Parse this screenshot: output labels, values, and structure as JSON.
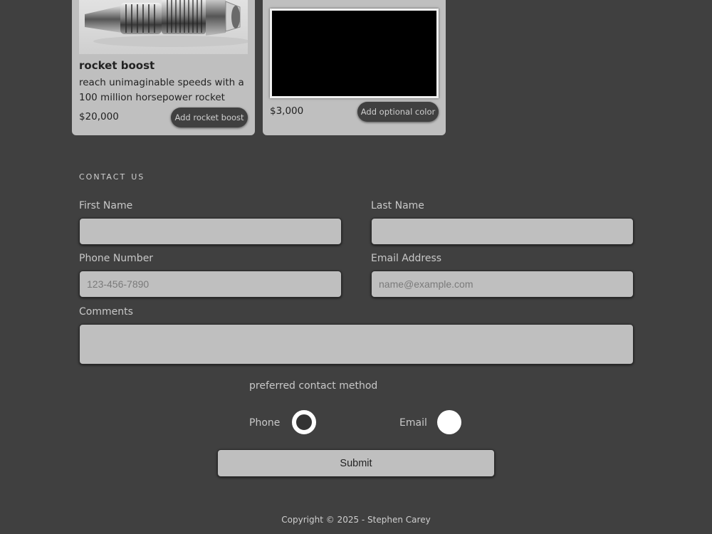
{
  "products": {
    "rocket": {
      "title": "rocket boost",
      "description": "reach unimaginable speeds with a 100 million horsepower rocket",
      "price": "$20,000",
      "button_label": "Add rocket boost"
    },
    "color": {
      "price": "$3,000",
      "button_label": "Add optional color",
      "swatch_color": "#000000"
    }
  },
  "contact": {
    "title": "CONTACT US",
    "first_name_label": "First Name",
    "first_name_value": "",
    "last_name_label": "Last Name",
    "last_name_value": "",
    "phone_label": "Phone Number",
    "phone_placeholder": "123-456-7890",
    "email_label": "Email Address",
    "email_placeholder": "name@example.com",
    "comments_label": "Comments",
    "comments_value": "",
    "preferred_label": "preferred contact method",
    "option_phone": "Phone",
    "option_email": "Email",
    "selected_method": "Phone",
    "submit_label": "Submit"
  },
  "footer": {
    "copyright": "Copyright © 2025 - Stephen Carey"
  },
  "colors": {
    "background": "#404040",
    "card": "#bfbfbf",
    "button_dark": "#404040"
  }
}
